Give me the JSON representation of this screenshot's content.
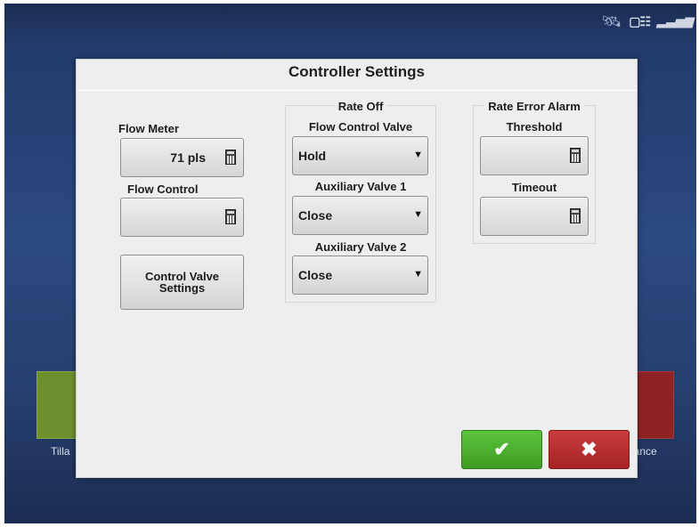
{
  "status_bar": {
    "satellite_icon": "satellite-icon",
    "gps_icon": "gps-device-icon",
    "signal_icon": "signal-strength-icon"
  },
  "background_apps": {
    "left_label": "Tilla",
    "right_label": "dance"
  },
  "dialog": {
    "title": "Controller Settings",
    "flow_meter": {
      "label": "Flow Meter",
      "value": "71 pls"
    },
    "flow_control": {
      "label": "Flow Control",
      "value": ""
    },
    "control_valve_button": "Control Valve Settings",
    "rate_off": {
      "heading": "Rate Off",
      "flow_control_valve": {
        "label": "Flow Control Valve",
        "value": "Hold"
      },
      "auxiliary_valve_1": {
        "label": "Auxiliary Valve 1",
        "value": "Close"
      },
      "auxiliary_valve_2": {
        "label": "Auxiliary Valve 2",
        "value": "Close"
      }
    },
    "rate_error_alarm": {
      "heading": "Rate Error Alarm",
      "threshold": {
        "label": "Threshold",
        "value": ""
      },
      "timeout": {
        "label": "Timeout",
        "value": ""
      }
    },
    "ok_symbol": "✔",
    "cancel_symbol": "✖"
  },
  "colors": {
    "accent_green": "#4caf32",
    "accent_red": "#b52d2d",
    "screen_blue": "#2b4a80"
  }
}
